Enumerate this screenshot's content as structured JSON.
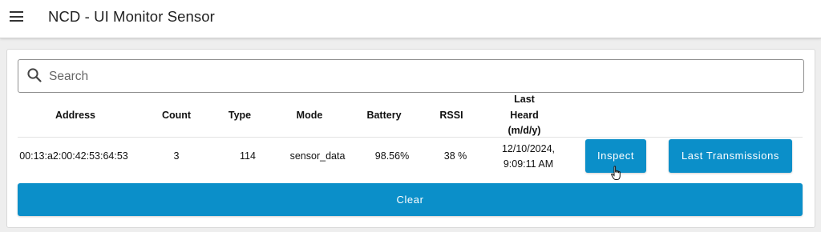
{
  "app": {
    "title": "NCD - UI Monitor Sensor"
  },
  "search": {
    "placeholder": "Search",
    "value": ""
  },
  "table": {
    "headers": {
      "address": "Address",
      "count": "Count",
      "type": "Type",
      "mode": "Mode",
      "battery": "Battery",
      "rssi": "RSSI",
      "last_heard_1": "Last",
      "last_heard_2": "Heard",
      "last_heard_3": "(m/d/y)"
    },
    "rows": [
      {
        "address": "00:13:a2:00:42:53:64:53",
        "count": "3",
        "type": "114",
        "mode": "sensor_data",
        "battery": "98.56%",
        "rssi": "38 %",
        "last_heard_date": "12/10/2024,",
        "last_heard_time": "9:09:11 AM",
        "inspect_label": "Inspect",
        "transmissions_label": "Last Transmissions"
      }
    ]
  },
  "actions": {
    "clear_label": "Clear"
  },
  "colors": {
    "accent": "#0b8fc9"
  }
}
